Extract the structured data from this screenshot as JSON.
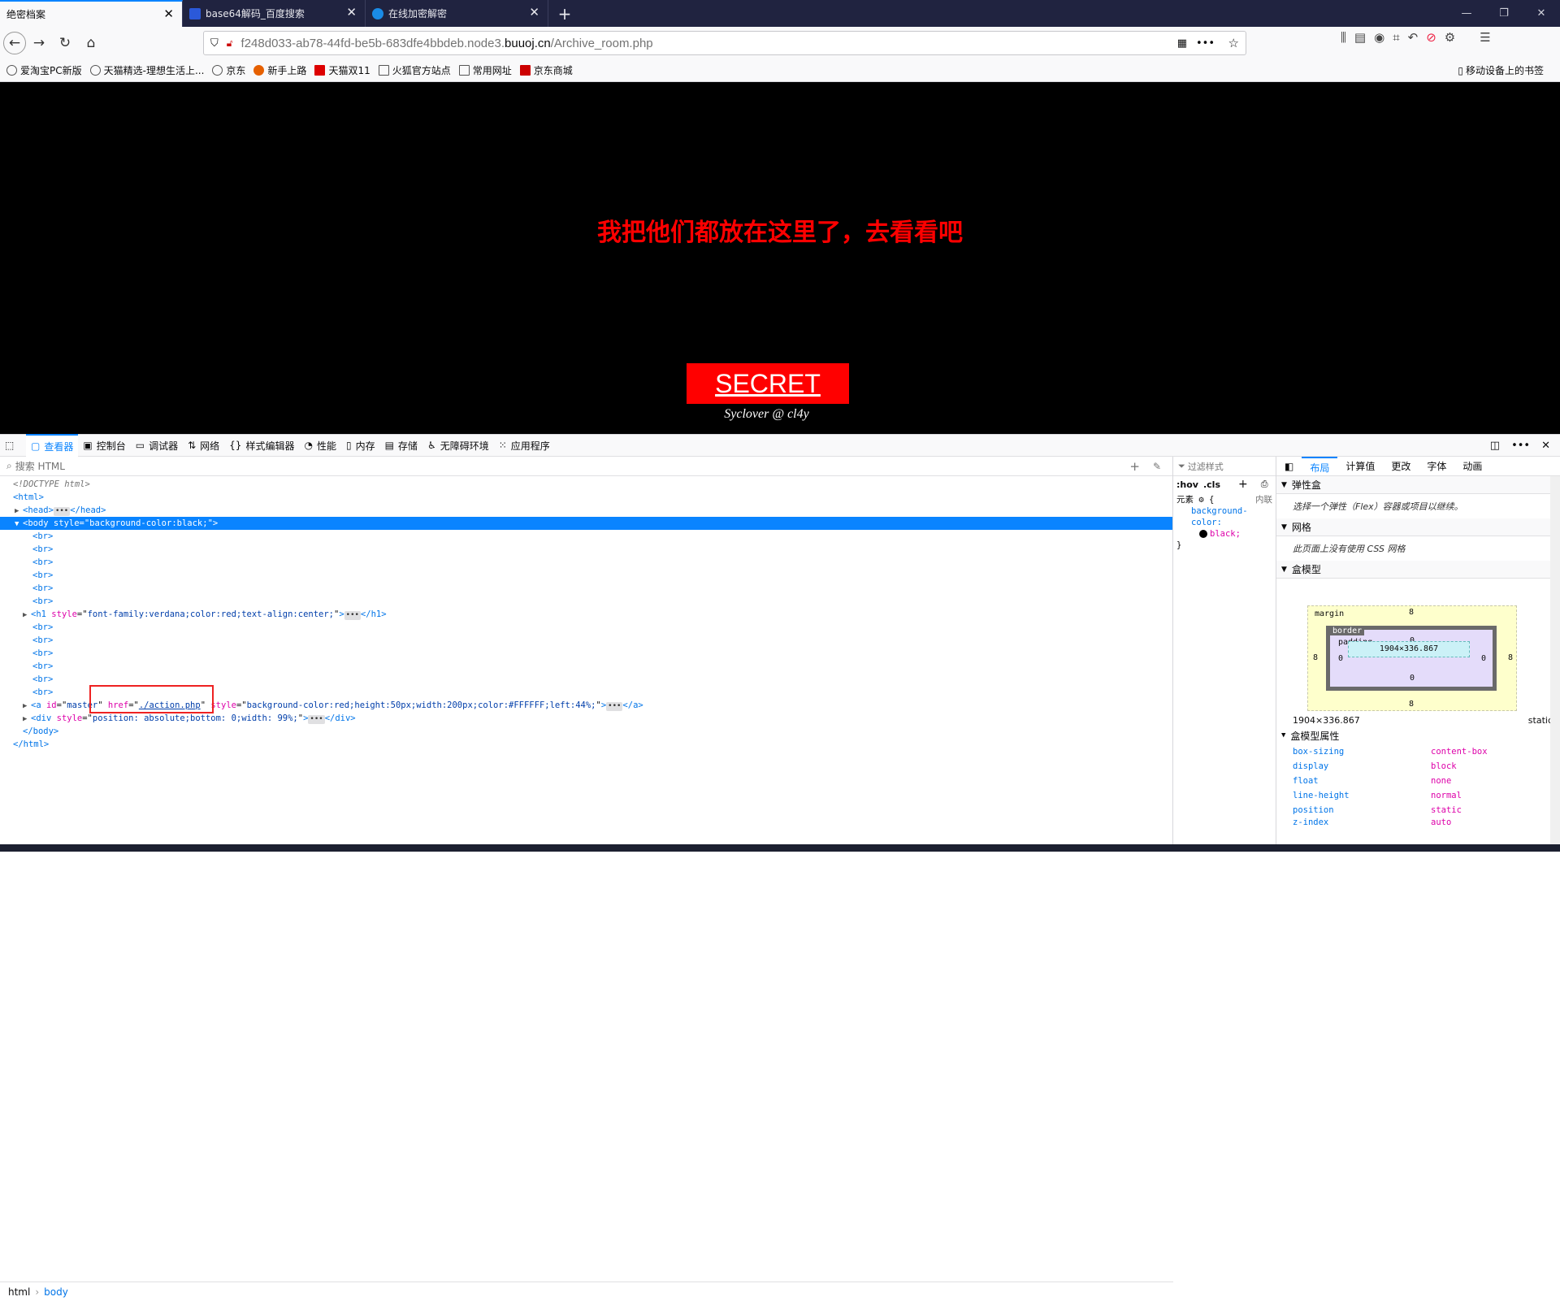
{
  "tabs": [
    {
      "label": "绝密档案",
      "active": true
    },
    {
      "label": "base64解码_百度搜索",
      "active": false
    },
    {
      "label": "在线加密解密",
      "active": false
    }
  ],
  "url": {
    "prefix": "f248d033-ab78-44fd-be5b-683dfe4bbdeb.node3.",
    "domain": "buuoj.cn",
    "path": "/Archive_room.php"
  },
  "bookmarks": [
    "爱淘宝PC新版",
    "天猫精选-理想生活上...",
    "京东",
    "新手上路",
    "天猫双11",
    "火狐官方站点",
    "常用网址",
    "京东商城"
  ],
  "mobile_bookmarks": "移动设备上的书签",
  "page": {
    "headline": "我把他们都放在这里了，去看看吧",
    "button": "SECRET",
    "signature": "Syclover @ cl4y"
  },
  "devtools": {
    "tabs": [
      "查看器",
      "控制台",
      "调试器",
      "网络",
      "样式编辑器",
      "性能",
      "内存",
      "存储",
      "无障碍环境",
      "应用程序"
    ],
    "search_placeholder": "搜索 HTML",
    "tree": {
      "doctype": "<!DOCTYPE html>",
      "html_open": "<html>",
      "head": "<head>",
      "head_close": "</head>",
      "body": "<body style=\"background-color:black;\">",
      "br": "<br>",
      "h1_tag": "<h1",
      "h1_style": "font-family:verdana;color:red;text-align:center;",
      "h1_close": "</h1>",
      "a_id": "master",
      "a_href": "./action.php",
      "a_style": "background-color:red;height:50px;width:200px;color:#FFFFFF;left:44%;",
      "a_close": "</a>",
      "div_style": "position: absolute;bottom: 0;width: 99%;",
      "div_close": "</div>",
      "body_close": "</body>",
      "html_close": "</html>"
    },
    "breadcrumbs": [
      "html",
      "body"
    ],
    "rules": {
      "filter": "过滤样式",
      "hov": ":hov",
      "cls": ".cls",
      "element": "元素",
      "inline": "内联",
      "prop": "background-color:",
      "value": "black;"
    },
    "layout_tabs": [
      "布局",
      "计算值",
      "更改",
      "字体",
      "动画"
    ],
    "sections": {
      "flex": "弹性盒",
      "flex_note": "选择一个弹性（Flex）容器或项目以继续。",
      "grid": "网格",
      "grid_note": "此页面上没有使用 CSS 网格",
      "box": "盒模型",
      "box_props": "盒模型属性"
    },
    "boxmodel": {
      "margin": "margin",
      "border": "border",
      "padding": "padding",
      "size": "1904×336.867",
      "margin_val": "8",
      "border_val": "0",
      "padding_val": "0",
      "size_line": "1904×336.867",
      "position_label": "static"
    },
    "props": [
      {
        "k": "box-sizing",
        "v": "content-box"
      },
      {
        "k": "display",
        "v": "block"
      },
      {
        "k": "float",
        "v": "none"
      },
      {
        "k": "line-height",
        "v": "normal"
      },
      {
        "k": "position",
        "v": "static"
      },
      {
        "k": "z-index",
        "v": "auto"
      }
    ]
  }
}
